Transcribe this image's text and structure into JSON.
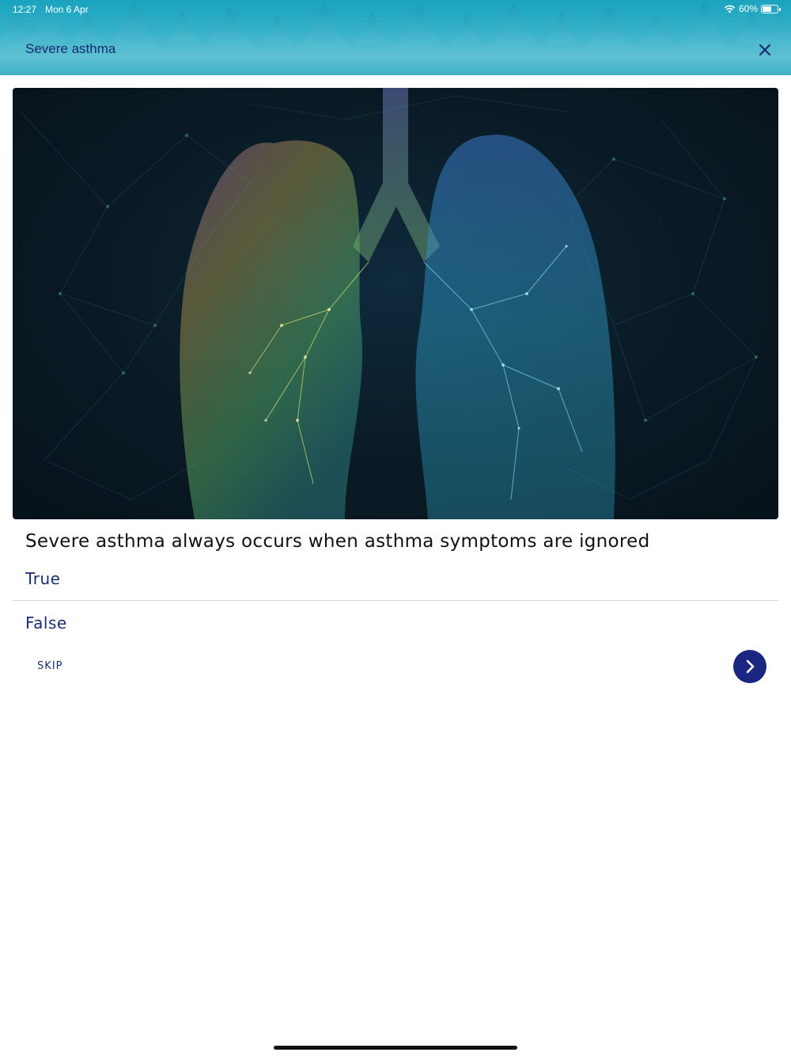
{
  "status_bar": {
    "time": "12:27",
    "date": "Mon 6 Apr",
    "battery_percent": "60%",
    "battery_level": 0.6
  },
  "header": {
    "title": "Severe asthma",
    "close_icon": "close-icon",
    "title_color": "#1b2c74"
  },
  "hero_image": {
    "subject": "lungs-network-illustration"
  },
  "question": {
    "text": "Severe asthma always occurs when asthma symptoms are ignored",
    "options": [
      {
        "label": "True"
      },
      {
        "label": "False"
      }
    ]
  },
  "footer": {
    "skip_label": "SKIP",
    "next_icon": "chevron-right-icon",
    "accent_color": "#1b2680"
  }
}
